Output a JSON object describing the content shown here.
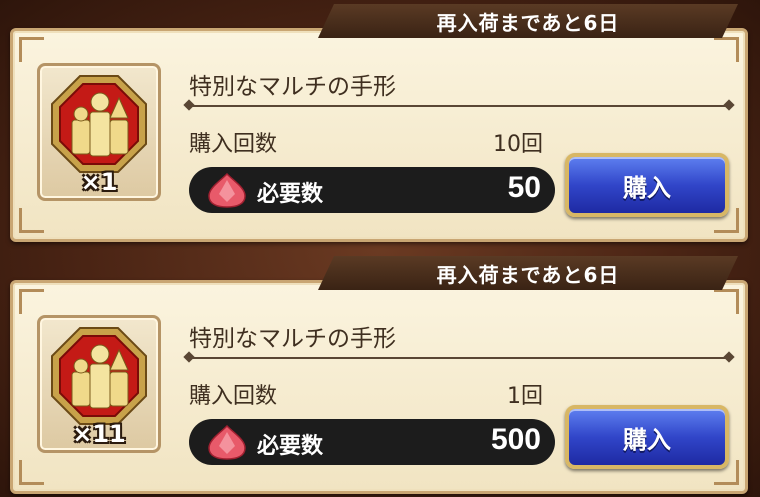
{
  "colors": {
    "panel_bg": "#fbf4df",
    "buy_button": "#3146c9",
    "cost_bar": "#1c1c1c",
    "tab_bg": "#4a2e1a"
  },
  "items": [
    {
      "restock_notice": "再入荷まであと6日",
      "name": "特別なマルチの手形",
      "quantity": "×1",
      "purchase_count_label": "購入回数",
      "purchase_count_value": "10回",
      "cost_icon": "red-gem-icon",
      "cost_label": "必要数",
      "cost_value": "50",
      "buy_label": "購入",
      "item_icon": "multi-pass-badge-icon"
    },
    {
      "restock_notice": "再入荷まであと6日",
      "name": "特別なマルチの手形",
      "quantity": "×11",
      "purchase_count_label": "購入回数",
      "purchase_count_value": "1回",
      "cost_icon": "red-gem-icon",
      "cost_label": "必要数",
      "cost_value": "500",
      "buy_label": "購入",
      "item_icon": "multi-pass-badge-icon"
    }
  ]
}
